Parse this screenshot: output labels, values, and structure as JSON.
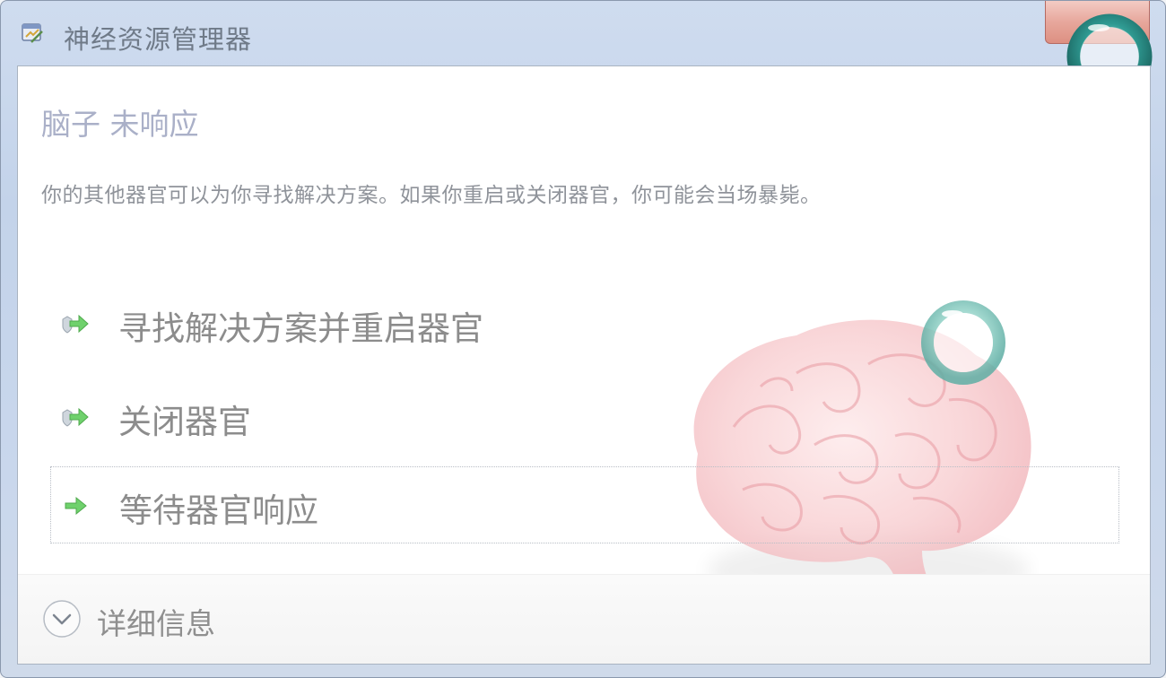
{
  "window": {
    "title": "神经资源管理器"
  },
  "dialog": {
    "heading": "脑子 未响应",
    "message": "你的其他器官可以为你寻找解决方案。如果你重启或关闭器官，你可能会当场暴毙。"
  },
  "options": [
    {
      "label": "寻找解决方案并重启器官",
      "icon": "shield-arrow-icon",
      "selected": false
    },
    {
      "label": "关闭器官",
      "icon": "shield-arrow-icon",
      "selected": false
    },
    {
      "label": "等待器官响应",
      "icon": "green-arrow-icon",
      "selected": true
    }
  ],
  "footer": {
    "details_label": "详细信息",
    "details_icon": "chevron-down-icon"
  },
  "colors": {
    "accent_green": "#5cc45a",
    "ring_teal": "#3fa7a0",
    "brain_pink": "#f2a7ad",
    "close_red": "#e7a79c"
  }
}
